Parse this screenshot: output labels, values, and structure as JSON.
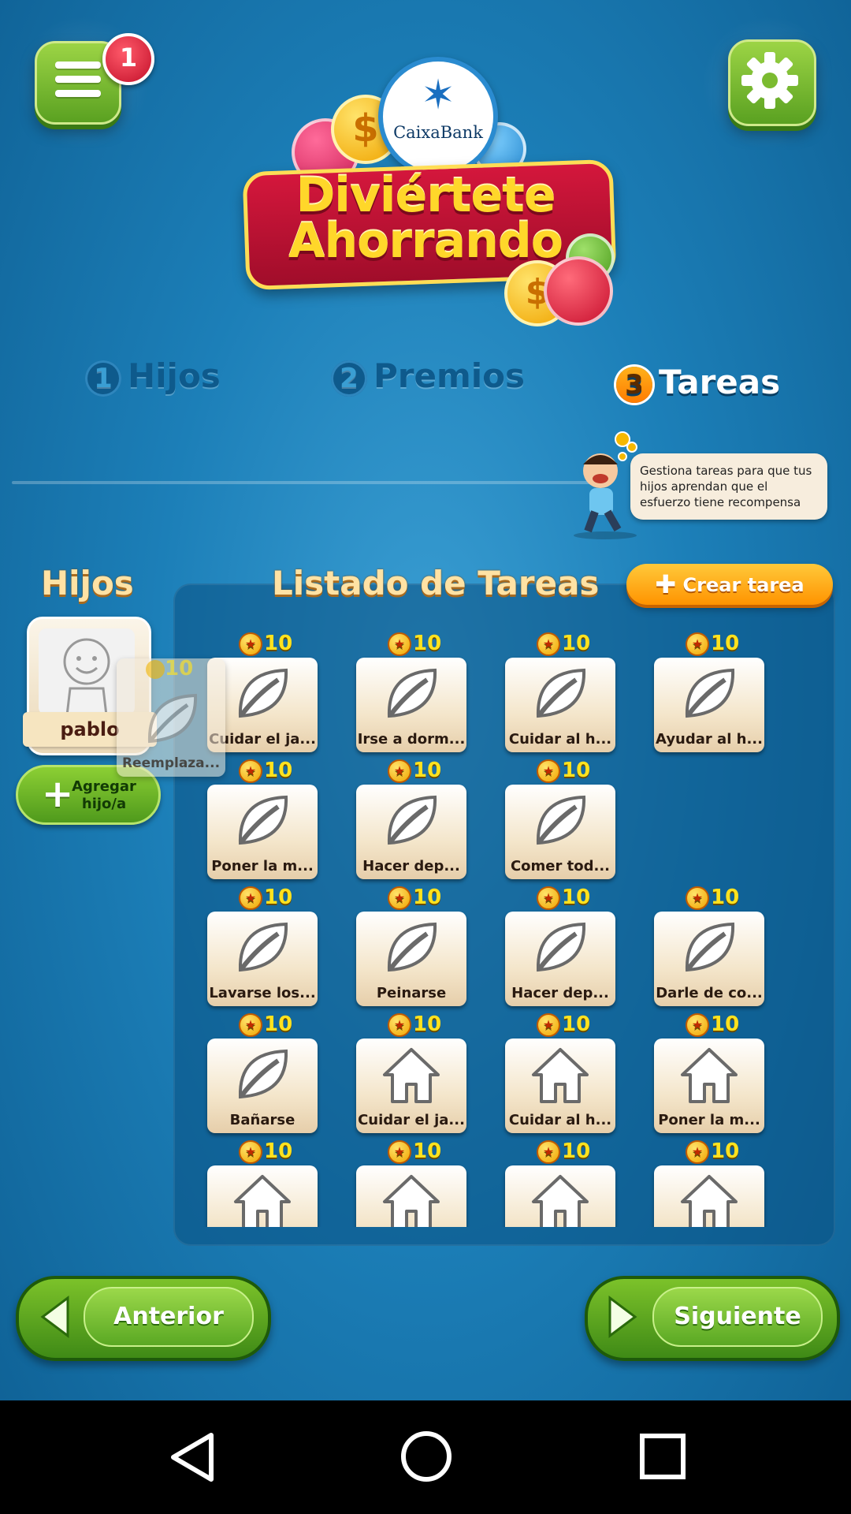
{
  "header": {
    "menu_badge": "1",
    "logo_brand": "CaixaBank",
    "logo_line1": "Diviértete",
    "logo_line2": "Ahorrando"
  },
  "steps": [
    {
      "num": "1",
      "label": "Hijos",
      "active": false
    },
    {
      "num": "2",
      "label": "Premios",
      "active": false
    },
    {
      "num": "3",
      "label": "Tareas",
      "active": true
    }
  ],
  "hint": "Gestiona tareas para que tus hijos aprendan que el esfuerzo tiene recompensa",
  "children": {
    "title": "Hijos",
    "items": [
      {
        "name": "pablo"
      }
    ],
    "add_label_1": "Agregar",
    "add_label_2": "hijo/a"
  },
  "tasks": {
    "title": "Listado de Tareas",
    "create_label": "Crear tarea",
    "dragging": {
      "points": "10",
      "label": "Reemplaza..."
    },
    "rows": [
      [
        {
          "points": "10",
          "label": "Cuidar el ja...",
          "icon": "leaf-icon"
        },
        {
          "points": "10",
          "label": "Irse a dorm...",
          "icon": "leaf-icon"
        },
        {
          "points": "10",
          "label": "Cuidar al h...",
          "icon": "leaf-icon"
        },
        {
          "points": "10",
          "label": "Ayudar al h...",
          "icon": "leaf-icon"
        }
      ],
      [
        {
          "points": "10",
          "label": "Poner la m...",
          "icon": "leaf-icon"
        },
        {
          "points": "10",
          "label": "Hacer dep...",
          "icon": "leaf-icon"
        },
        {
          "points": "10",
          "label": "Comer tod...",
          "icon": "leaf-icon"
        }
      ],
      [
        {
          "points": "10",
          "label": "Lavarse los...",
          "icon": "leaf-icon"
        },
        {
          "points": "10",
          "label": "Peinarse",
          "icon": "leaf-icon"
        },
        {
          "points": "10",
          "label": "Hacer dep...",
          "icon": "leaf-icon"
        },
        {
          "points": "10",
          "label": "Darle de co...",
          "icon": "leaf-icon"
        }
      ],
      [
        {
          "points": "10",
          "label": "Bañarse",
          "icon": "leaf-icon"
        },
        {
          "points": "10",
          "label": "Cuidar el ja...",
          "icon": "house-icon"
        },
        {
          "points": "10",
          "label": "Cuidar al h...",
          "icon": "house-icon"
        },
        {
          "points": "10",
          "label": "Poner la m...",
          "icon": "house-icon"
        }
      ],
      [
        {
          "points": "10",
          "label": "",
          "icon": "house-icon"
        },
        {
          "points": "10",
          "label": "",
          "icon": "house-icon"
        },
        {
          "points": "10",
          "label": "",
          "icon": "house-icon"
        },
        {
          "points": "10",
          "label": "",
          "icon": "house-icon"
        }
      ]
    ]
  },
  "footer": {
    "prev_label": "Anterior",
    "next_label": "Siguiente"
  },
  "colors": {
    "accent_green": "#5aa121",
    "accent_orange": "#ff9300",
    "points_yellow": "#ffe21f"
  }
}
